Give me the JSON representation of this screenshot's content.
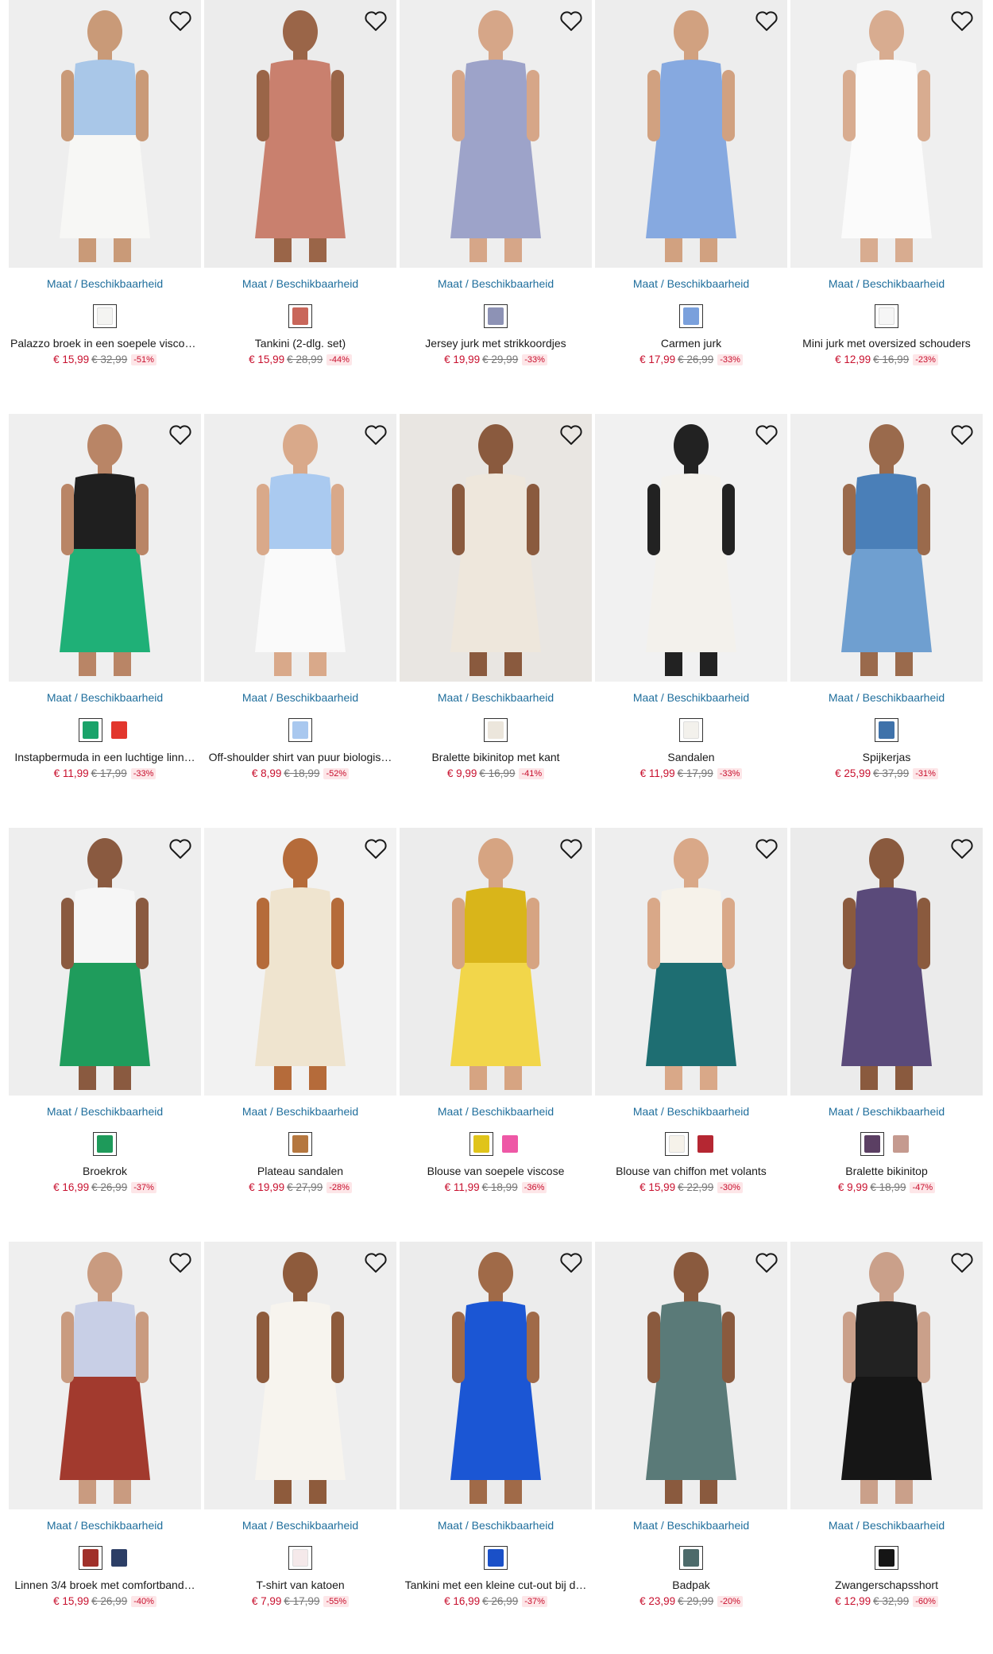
{
  "size_link_label": "Maat / Beschikbaarheid",
  "icons": {
    "wishlist": "heart-outline-icon"
  },
  "colors": {
    "price": "#c8102e",
    "link": "#1f6e9c",
    "discount_bg": "#fde6e8"
  },
  "products": [
    {
      "name": "Palazzo broek in een soepele viscos…",
      "price": "€ 15,99",
      "old_price": "€ 32,99",
      "discount": "-51%",
      "swatches": [
        "#f4f4f2"
      ],
      "bg": "#eeeeee",
      "fig": "#f7f7f5",
      "skin": "#c99a78",
      "top": "#a9c7e8"
    },
    {
      "name": "Tankini (2-dlg. set)",
      "price": "€ 15,99",
      "old_price": "€ 28,99",
      "discount": "-44%",
      "swatches": [
        "#c9665a"
      ],
      "bg": "#ececec",
      "fig": "#c9806e",
      "skin": "#9a6548",
      "top": "#c9806e"
    },
    {
      "name": "Jersey jurk met strikkoordjes",
      "price": "€ 19,99",
      "old_price": "€ 29,99",
      "discount": "-33%",
      "swatches": [
        "#8d92b5"
      ],
      "bg": "#eeeeee",
      "fig": "#9da3c9",
      "skin": "#d6a688",
      "top": "#9da3c9"
    },
    {
      "name": "Carmen jurk",
      "price": "€ 17,99",
      "old_price": "€ 26,99",
      "discount": "-33%",
      "swatches": [
        "#7aa0dc"
      ],
      "bg": "#ededed",
      "fig": "#86a9e0",
      "skin": "#d1a180",
      "top": "#86a9e0"
    },
    {
      "name": "Mini jurk met oversized schouders",
      "price": "€ 12,99",
      "old_price": "€ 16,99",
      "discount": "-23%",
      "swatches": [
        "#f6f6f6"
      ],
      "bg": "#efefef",
      "fig": "#fbfbfb",
      "skin": "#d8ac90",
      "top": "#fbfbfb"
    },
    {
      "name": "Instapbermuda in een luchtige linn…",
      "price": "€ 11,99",
      "old_price": "€ 17,99",
      "discount": "-33%",
      "swatches": [
        "#1aa36a",
        "#e2362c"
      ],
      "bg": "#efefef",
      "fig": "#1fb077",
      "skin": "#b98566",
      "top": "#1f1f1f"
    },
    {
      "name": "Off-shoulder shirt van puur biologis…",
      "price": "€ 8,99",
      "old_price": "€ 18,99",
      "discount": "-52%",
      "swatches": [
        "#a9c8ef"
      ],
      "bg": "#eeeeee",
      "fig": "#fafafa",
      "skin": "#d9a98a",
      "top": "#aacaf0"
    },
    {
      "name": "Bralette bikinitop met kant",
      "price": "€ 9,99",
      "old_price": "€ 16,99",
      "discount": "-41%",
      "swatches": [
        "#ece6dc"
      ],
      "bg": "#e9e6e2",
      "fig": "#eee7dc",
      "skin": "#8a5a3e",
      "top": "#eee7dc"
    },
    {
      "name": "Sandalen",
      "price": "€ 11,99",
      "old_price": "€ 17,99",
      "discount": "-33%",
      "swatches": [
        "#f3f1ec"
      ],
      "bg": "#f1f1f1",
      "fig": "#f3f1ec",
      "skin": "#222222",
      "top": "#f3f1ec"
    },
    {
      "name": "Spijkerjas",
      "price": "€ 25,99",
      "old_price": "€ 37,99",
      "discount": "-31%",
      "swatches": [
        "#3f72aa"
      ],
      "bg": "#efefef",
      "fig": "#6f9fd0",
      "skin": "#9a6a4c",
      "top": "#4a7fb8"
    },
    {
      "name": "Broekrok",
      "price": "€ 16,99",
      "old_price": "€ 26,99",
      "discount": "-37%",
      "swatches": [
        "#1e9a5a"
      ],
      "bg": "#eeeeee",
      "fig": "#1f9c5c",
      "skin": "#8a5a40",
      "top": "#f6f6f6"
    },
    {
      "name": "Plateau sandalen",
      "price": "€ 19,99",
      "old_price": "€ 27,99",
      "discount": "-28%",
      "swatches": [
        "#b5773f"
      ],
      "bg": "#f2f2f2",
      "fig": "#efe4cf",
      "skin": "#b56b3a",
      "top": "#efe4cf"
    },
    {
      "name": "Blouse van soepele viscose",
      "price": "€ 11,99",
      "old_price": "€ 18,99",
      "discount": "-36%",
      "swatches": [
        "#e0c41a",
        "#ee58a6"
      ],
      "bg": "#ececec",
      "fig": "#f2d64a",
      "skin": "#d6a482",
      "top": "#d9b51a"
    },
    {
      "name": "Blouse van chiffon met volants",
      "price": "€ 15,99",
      "old_price": "€ 22,99",
      "discount": "-30%",
      "swatches": [
        "#f6f2ea",
        "#b52732"
      ],
      "bg": "#eeeeee",
      "fig": "#1e6e72",
      "skin": "#d9a888",
      "top": "#f6f2ea"
    },
    {
      "name": "Bralette bikinitop",
      "price": "€ 9,99",
      "old_price": "€ 18,99",
      "discount": "-47%",
      "swatches": [
        "#5b3f63",
        "#c59a8f"
      ],
      "bg": "#ebebeb",
      "fig": "#5a4a7a",
      "skin": "#8a5a3e",
      "top": "#5a4a7a"
    },
    {
      "name": "Linnen 3/4 broek met comfortband…",
      "price": "€ 15,99",
      "old_price": "€ 26,99",
      "discount": "-40%",
      "swatches": [
        "#a0302a",
        "#2c3e66"
      ],
      "bg": "#efefef",
      "fig": "#a23a2e",
      "skin": "#c99b80",
      "top": "#c8cfe6"
    },
    {
      "name": "T-shirt van katoen",
      "price": "€ 7,99",
      "old_price": "€ 17,99",
      "discount": "-55%",
      "swatches": [
        "#f5e9ea"
      ],
      "bg": "#eeeeee",
      "fig": "#f7f4ee",
      "skin": "#8e5b3c",
      "top": "#f7f4ee"
    },
    {
      "name": "Tankini met een kleine cut-out bij d…",
      "price": "€ 16,99",
      "old_price": "€ 26,99",
      "discount": "-37%",
      "swatches": [
        "#1a50c8"
      ],
      "bg": "#ececec",
      "fig": "#1b56d4",
      "skin": "#a06a48",
      "top": "#1b56d4"
    },
    {
      "name": "Badpak",
      "price": "€ 23,99",
      "old_price": "€ 29,99",
      "discount": "-20%",
      "swatches": [
        "#4c6a6a"
      ],
      "bg": "#eeeeee",
      "fig": "#5a7a78",
      "skin": "#8a5a3e",
      "top": "#5a7a78"
    },
    {
      "name": "Zwangerschapsshort",
      "price": "€ 12,99",
      "old_price": "€ 32,99",
      "discount": "-60%",
      "swatches": [
        "#151515"
      ],
      "bg": "#efefef",
      "fig": "#161616",
      "skin": "#caa08a",
      "top": "#222222"
    }
  ]
}
